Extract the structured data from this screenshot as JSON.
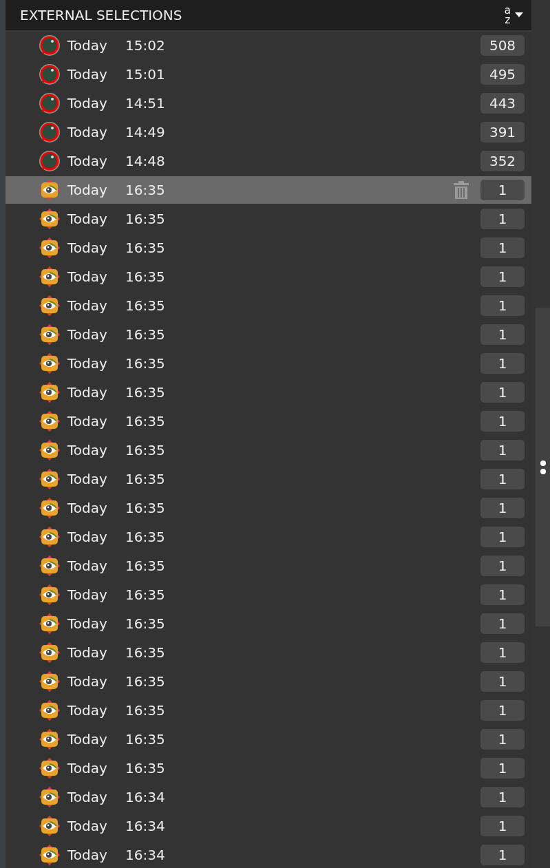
{
  "panel": {
    "title": "EXTERNAL SELECTIONS",
    "sort": {
      "top": "a",
      "bottom": "z"
    }
  },
  "rows": [
    {
      "kind": "viewer",
      "day": "Today",
      "time": "15:02",
      "count": "508",
      "selected": false
    },
    {
      "kind": "viewer",
      "day": "Today",
      "time": "15:01",
      "count": "495",
      "selected": false
    },
    {
      "kind": "viewer",
      "day": "Today",
      "time": "14:51",
      "count": "443",
      "selected": false
    },
    {
      "kind": "viewer",
      "day": "Today",
      "time": "14:49",
      "count": "391",
      "selected": false
    },
    {
      "kind": "viewer",
      "day": "Today",
      "time": "14:48",
      "count": "352",
      "selected": false
    },
    {
      "kind": "eye",
      "day": "Today",
      "time": "16:35",
      "count": "1",
      "selected": true
    },
    {
      "kind": "eye",
      "day": "Today",
      "time": "16:35",
      "count": "1",
      "selected": false
    },
    {
      "kind": "eye",
      "day": "Today",
      "time": "16:35",
      "count": "1",
      "selected": false
    },
    {
      "kind": "eye",
      "day": "Today",
      "time": "16:35",
      "count": "1",
      "selected": false
    },
    {
      "kind": "eye",
      "day": "Today",
      "time": "16:35",
      "count": "1",
      "selected": false
    },
    {
      "kind": "eye",
      "day": "Today",
      "time": "16:35",
      "count": "1",
      "selected": false
    },
    {
      "kind": "eye",
      "day": "Today",
      "time": "16:35",
      "count": "1",
      "selected": false
    },
    {
      "kind": "eye",
      "day": "Today",
      "time": "16:35",
      "count": "1",
      "selected": false
    },
    {
      "kind": "eye",
      "day": "Today",
      "time": "16:35",
      "count": "1",
      "selected": false
    },
    {
      "kind": "eye",
      "day": "Today",
      "time": "16:35",
      "count": "1",
      "selected": false
    },
    {
      "kind": "eye",
      "day": "Today",
      "time": "16:35",
      "count": "1",
      "selected": false
    },
    {
      "kind": "eye",
      "day": "Today",
      "time": "16:35",
      "count": "1",
      "selected": false
    },
    {
      "kind": "eye",
      "day": "Today",
      "time": "16:35",
      "count": "1",
      "selected": false
    },
    {
      "kind": "eye",
      "day": "Today",
      "time": "16:35",
      "count": "1",
      "selected": false
    },
    {
      "kind": "eye",
      "day": "Today",
      "time": "16:35",
      "count": "1",
      "selected": false
    },
    {
      "kind": "eye",
      "day": "Today",
      "time": "16:35",
      "count": "1",
      "selected": false
    },
    {
      "kind": "eye",
      "day": "Today",
      "time": "16:35",
      "count": "1",
      "selected": false
    },
    {
      "kind": "eye",
      "day": "Today",
      "time": "16:35",
      "count": "1",
      "selected": false
    },
    {
      "kind": "eye",
      "day": "Today",
      "time": "16:35",
      "count": "1",
      "selected": false
    },
    {
      "kind": "eye",
      "day": "Today",
      "time": "16:35",
      "count": "1",
      "selected": false
    },
    {
      "kind": "eye",
      "day": "Today",
      "time": "16:35",
      "count": "1",
      "selected": false
    },
    {
      "kind": "eye",
      "day": "Today",
      "time": "16:34",
      "count": "1",
      "selected": false
    },
    {
      "kind": "eye",
      "day": "Today",
      "time": "16:34",
      "count": "1",
      "selected": false
    },
    {
      "kind": "eye",
      "day": "Today",
      "time": "16:34",
      "count": "1",
      "selected": false
    }
  ]
}
